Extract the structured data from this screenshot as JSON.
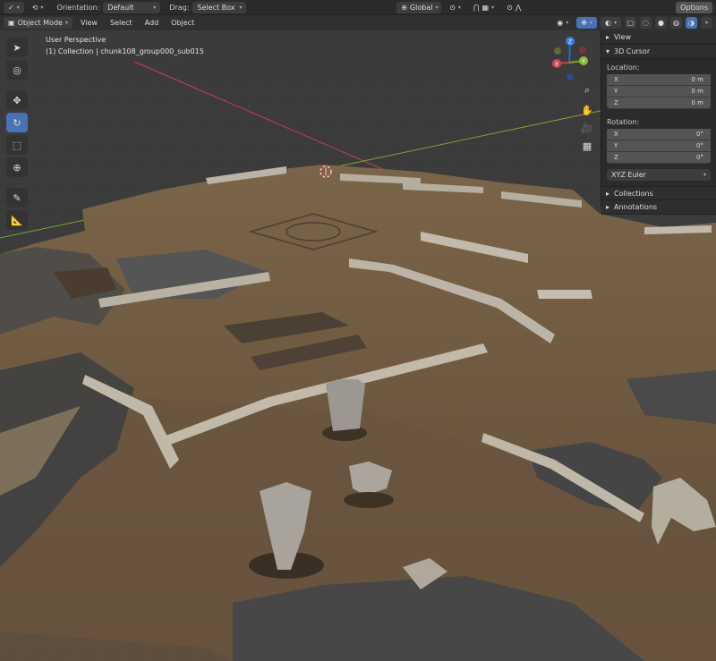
{
  "toolbar_top": {
    "orientation_label": "Orientation:",
    "orientation_value": "Default",
    "drag_label": "Drag:",
    "drag_value": "Select Box",
    "transform_space": "Global",
    "options_label": "Options"
  },
  "toolbar_menu": {
    "mode": "Object Mode",
    "view": "View",
    "select": "Select",
    "add": "Add",
    "object": "Object"
  },
  "viewport": {
    "perspective": "User Perspective",
    "collection_info": "(1) Collection | chunk108_group000_sub015"
  },
  "gizmo": {
    "x": "X",
    "y": "Y",
    "z": "Z"
  },
  "npanel": {
    "view_label": "View",
    "cursor_label": "3D Cursor",
    "location_label": "Location:",
    "location": [
      {
        "axis": "X",
        "value": "0 m"
      },
      {
        "axis": "Y",
        "value": "0 m"
      },
      {
        "axis": "Z",
        "value": "0 m"
      }
    ],
    "rotation_label": "Rotation:",
    "rotation": [
      {
        "axis": "X",
        "value": "0°"
      },
      {
        "axis": "Y",
        "value": "0°"
      },
      {
        "axis": "Z",
        "value": "0°"
      }
    ],
    "rotation_mode": "XYZ Euler",
    "collections_label": "Collections",
    "annotations_label": "Annotations"
  },
  "colors": {
    "accent": "#4772b3",
    "axis_x": "#c4424f",
    "axis_y": "#7ca239",
    "floor": "#6e5a42",
    "wall": "#b9b2a3"
  }
}
